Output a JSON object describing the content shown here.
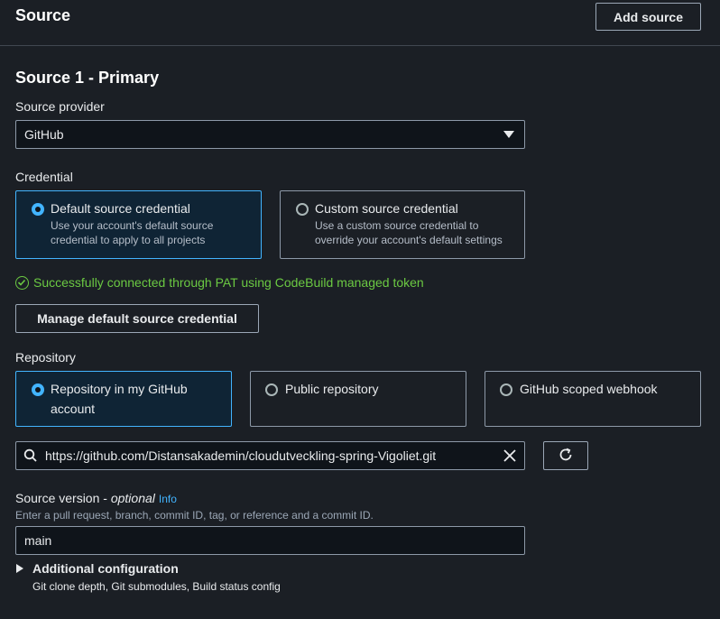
{
  "header": {
    "title": "Source",
    "add_source_label": "Add source"
  },
  "section": {
    "title": "Source 1 - Primary"
  },
  "source_provider": {
    "label": "Source provider",
    "value": "GitHub"
  },
  "credential": {
    "label": "Credential",
    "options": [
      {
        "title": "Default source credential",
        "description": "Use your account's default source credential to apply to all projects",
        "desc_line1": "Use your account's default source",
        "desc_line2": "credential to apply to all projects",
        "selected": true
      },
      {
        "title": "Custom source credential",
        "description": "Use a custom source credential to override your account's default settings",
        "desc_line1": "Use a custom source credential to",
        "desc_line2": "override your account's default settings",
        "selected": false
      }
    ],
    "status": "Successfully connected through PAT using CodeBuild managed token",
    "manage_label": "Manage default source credential"
  },
  "repository": {
    "label": "Repository",
    "options": [
      {
        "title_line1": "Repository in my GitHub",
        "title_line2": "account",
        "selected": true
      },
      {
        "title_line1": "Public repository",
        "selected": false
      },
      {
        "title_line1": "GitHub scoped webhook",
        "selected": false
      }
    ],
    "url": "https://github.com/Distansakademin/cloudutveckling-spring-Vigoliet.git"
  },
  "source_version": {
    "label": "Source version",
    "optional": "optional",
    "info": "Info",
    "hint": "Enter a pull request, branch, commit ID, tag, or reference and a commit ID.",
    "value": "main"
  },
  "additional_config": {
    "title": "Additional configuration",
    "description": "Git clone depth, Git submodules, Build status config"
  },
  "colors": {
    "accent": "#42b4ff",
    "success": "#6bc942",
    "background": "#1b1f25"
  }
}
